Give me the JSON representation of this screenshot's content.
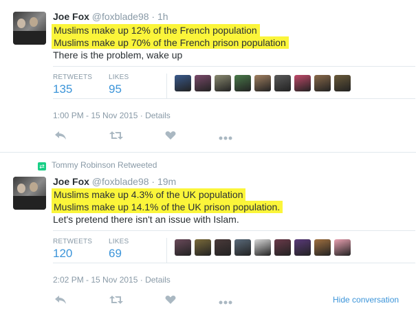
{
  "tweet1": {
    "name": "Joe Fox",
    "handle": "@foxblade98",
    "separator": "·",
    "time": "1h",
    "lines_highlighted": [
      "Muslims make up 12% of the French population",
      "Muslims make up 70% of the French prison population"
    ],
    "line_plain": "There is the problem, wake up",
    "retweets_label": "RETWEETS",
    "retweets_count": "135",
    "likes_label": "LIKES",
    "likes_count": "95",
    "timestamp": "1:00 PM - 15 Nov 2015",
    "details_label": "Details",
    "liker_avatar_colors": [
      "#3a5a8c",
      "#7a4a6a",
      "#8a8a70",
      "#4a7a4a",
      "#a08060",
      "#5a5a5a",
      "#c04a6a",
      "#8a6a4a",
      "#6a5a3a"
    ]
  },
  "tweet2": {
    "retweeted_by": "Tommy Robinson Retweeted",
    "name": "Joe Fox",
    "handle": "@foxblade98",
    "separator": "·",
    "time": "19m",
    "lines_highlighted": [
      "Muslims make up 4.3% of the UK population",
      "Muslims make up 14.1% of the UK prison population."
    ],
    "line_plain": "Let's pretend there isn't an issue with Islam.",
    "retweets_label": "RETWEETS",
    "retweets_count": "120",
    "likes_label": "LIKES",
    "likes_count": "69",
    "timestamp": "2:02 PM - 15 Nov 2015",
    "details_label": "Details",
    "hide_conversation": "Hide conversation",
    "liker_avatar_colors": [
      "#6a4a5a",
      "#7a6a3a",
      "#4a3a3a",
      "#5a6a7a",
      "#d8d8d8",
      "#6a3a4a",
      "#5a3a7a",
      "#a07040",
      "#e8a0b0"
    ]
  },
  "icons": [
    "reply-icon",
    "retweet-icon",
    "like-icon",
    "more-icon"
  ],
  "colors": {
    "highlight": "#fbf53a",
    "link": "#3b94d9",
    "muted": "#8899a6",
    "retweet_green": "#19cf86"
  }
}
